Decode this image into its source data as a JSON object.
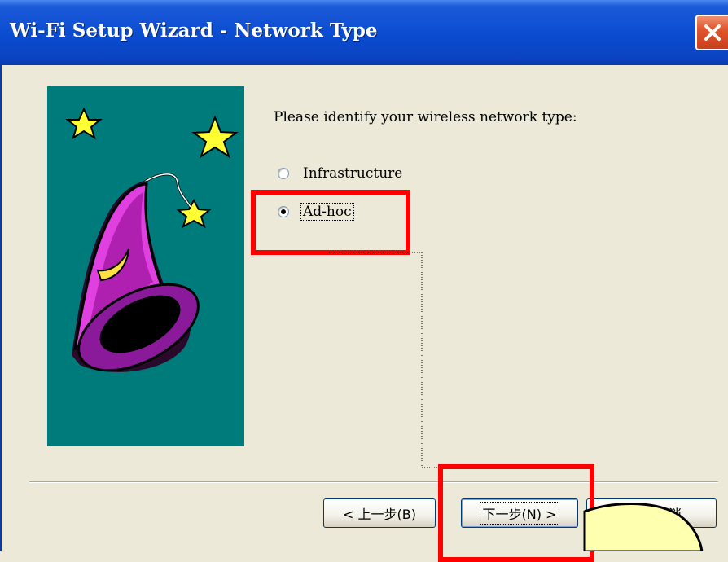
{
  "window": {
    "title": "Wi-Fi Setup Wizard - Network Type"
  },
  "content": {
    "prompt": "Please identify your wireless network type:",
    "options": [
      {
        "label": "Infrastructure",
        "selected": false
      },
      {
        "label": "Ad-hoc",
        "selected": true
      }
    ]
  },
  "buttons": {
    "back": "< 上一步(B)",
    "next": "下一步(N) >",
    "cancel": "取消"
  },
  "colors": {
    "titlebar": "#0a4bd0",
    "wizard_panel_bg": "#007b7b",
    "annotation_red": "#ff0000",
    "callout_fill": "#ffffb0"
  },
  "icons": {
    "wizard": "wizard-hat-with-stars",
    "close": "close-x-icon"
  }
}
